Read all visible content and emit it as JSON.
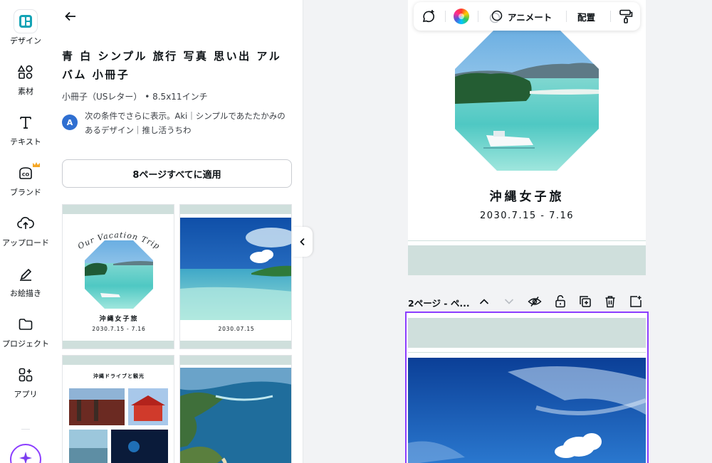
{
  "rail": {
    "items": [
      {
        "label": "デザイン",
        "icon": "design-icon"
      },
      {
        "label": "素材",
        "icon": "elements-icon"
      },
      {
        "label": "テキスト",
        "icon": "text-icon"
      },
      {
        "label": "ブランド",
        "icon": "brand-icon"
      },
      {
        "label": "アップロード",
        "icon": "upload-icon"
      },
      {
        "label": "お絵描き",
        "icon": "draw-icon"
      },
      {
        "label": "プロジェクト",
        "icon": "folder-icon"
      },
      {
        "label": "アプリ",
        "icon": "apps-icon"
      }
    ]
  },
  "panel": {
    "title": "青 白 シンプル 旅行 写真 思い出 アルバム 小冊子",
    "size": "小冊子（USレター） • 8.5x11インチ",
    "author_initial": "A",
    "author_text": "次の条件でさらに表示。Aki｜シンプルであたたかみのあるデザイン｜推し活うちわ",
    "apply_label": "8ページすべてに適用",
    "thumbs": {
      "t1_script": "Our Vacation Trip",
      "t1_title": "沖縄女子旅",
      "t1_date": "2030.7.15 - 7.16",
      "t2_date": "2030.07.15",
      "t3_title": "沖縄ドライブと観光"
    }
  },
  "toolbar": {
    "animate_label": "アニメート",
    "position_label": "配置"
  },
  "canvas": {
    "page1_title": "沖縄女子旅",
    "page1_date": "2030.7.15 - 7.16",
    "page2_label": "2ページ - ペ..."
  },
  "colors": {
    "accent": "#8b3dff",
    "band": "#cfdfdc",
    "avatar": "#2f6fd1"
  }
}
